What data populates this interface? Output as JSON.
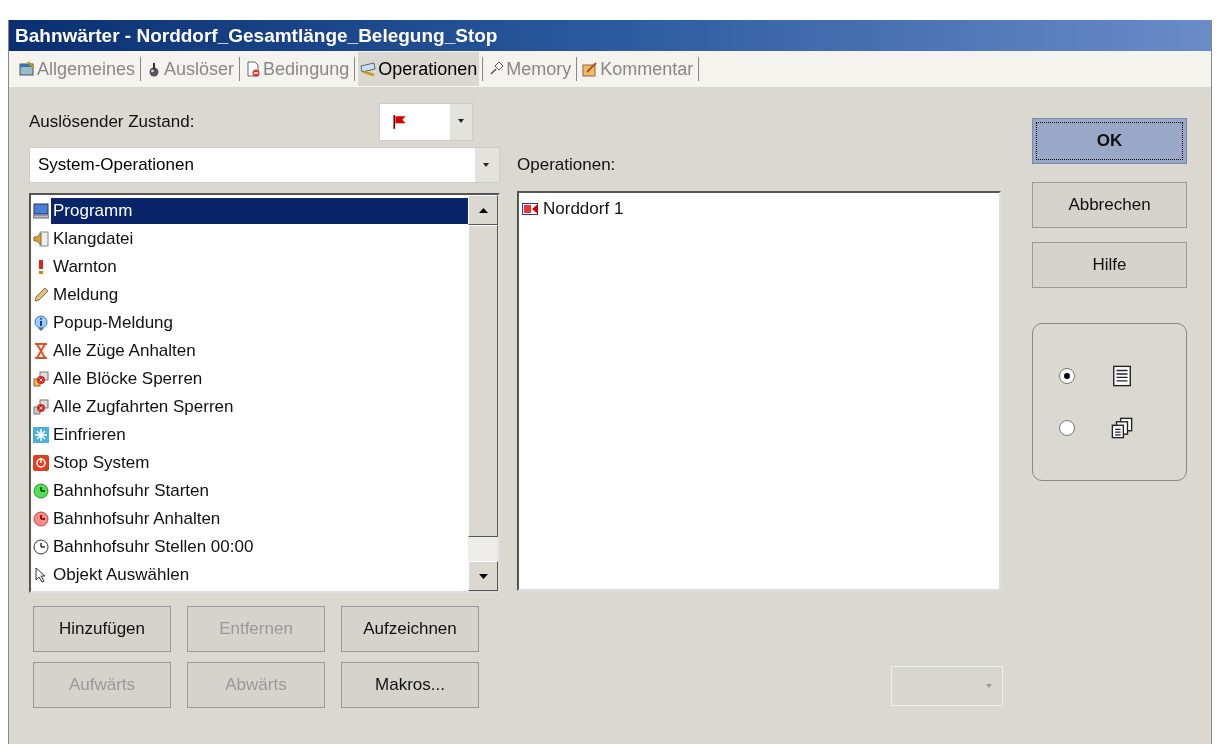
{
  "window": {
    "title": "Bahnwärter - Norddorf_Gesamtlänge_Belegung_Stop"
  },
  "tabs": [
    {
      "label": "Allgemeines",
      "selected": false
    },
    {
      "label": "Auslöser",
      "selected": false
    },
    {
      "label": "Bedingung",
      "selected": false
    },
    {
      "label": "Operationen",
      "selected": true
    },
    {
      "label": "Memory",
      "selected": false
    },
    {
      "label": "Kommentar",
      "selected": false
    }
  ],
  "trigger_state": {
    "label": "Auslösender Zustand:"
  },
  "category_combo": {
    "value": "System-Operationen"
  },
  "available_operations": [
    {
      "label": "Programm",
      "selected": true
    },
    {
      "label": "Klangdatei",
      "selected": false
    },
    {
      "label": "Warnton",
      "selected": false
    },
    {
      "label": "Meldung",
      "selected": false
    },
    {
      "label": "Popup-Meldung",
      "selected": false
    },
    {
      "label": "Alle Züge Anhalten",
      "selected": false
    },
    {
      "label": "Alle Blöcke Sperren",
      "selected": false
    },
    {
      "label": "Alle Zugfahrten Sperren",
      "selected": false
    },
    {
      "label": "Einfrieren",
      "selected": false
    },
    {
      "label": "Stop System",
      "selected": false
    },
    {
      "label": "Bahnhofsuhr Starten",
      "selected": false
    },
    {
      "label": "Bahnhofsuhr Anhalten",
      "selected": false
    },
    {
      "label": "Bahnhofsuhr Stellen 00:00",
      "selected": false
    },
    {
      "label": "Objekt Auswählen",
      "selected": false
    }
  ],
  "operations": {
    "label": "Operationen:",
    "items": [
      {
        "label": "Norddorf 1"
      }
    ]
  },
  "list_buttons": [
    {
      "label": "Hinzufügen",
      "disabled": false
    },
    {
      "label": "Entfernen",
      "disabled": true
    },
    {
      "label": "Aufzeichnen",
      "disabled": false
    },
    {
      "label": "Aufwärts",
      "disabled": true
    },
    {
      "label": "Abwärts",
      "disabled": true
    },
    {
      "label": "Makros...",
      "disabled": false
    }
  ],
  "dialog_buttons": [
    {
      "label": "OK",
      "default": true
    },
    {
      "label": "Abbrechen",
      "default": false
    },
    {
      "label": "Hilfe",
      "default": false
    }
  ],
  "view_options": [
    {
      "selected": true
    },
    {
      "selected": false
    }
  ]
}
